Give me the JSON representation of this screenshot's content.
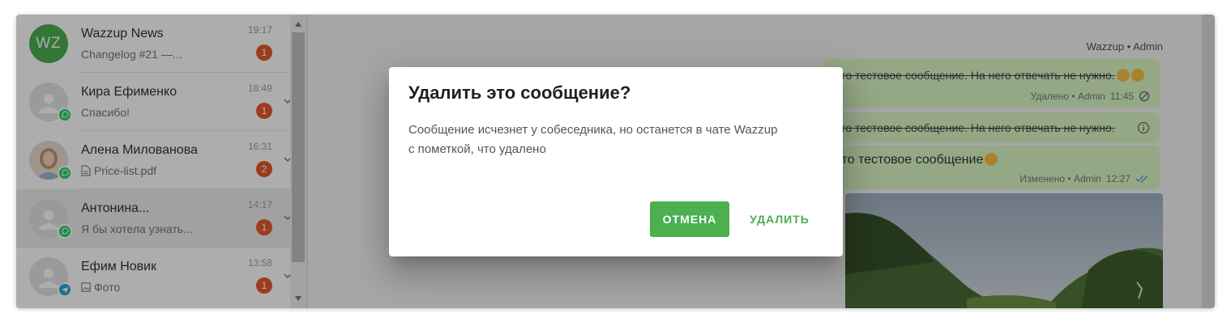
{
  "chats": [
    {
      "avatar_initials": "WZ",
      "name": "Wazzup News",
      "preview": "Changelog #21 —...",
      "time": "19:17",
      "unread": "1",
      "channel": null,
      "preview_icon": null
    },
    {
      "name": "Кира Ефименко",
      "preview": "Спасибо!",
      "time": "18:49",
      "unread": "1",
      "channel": "whatsapp",
      "preview_icon": null
    },
    {
      "name": "Алена Милованова",
      "preview": "Price-list.pdf",
      "time": "16:31",
      "unread": "2",
      "channel": "whatsapp",
      "preview_icon": "document-icon"
    },
    {
      "name": "Антонина...",
      "preview": "Я бы хотела узнать...",
      "time": "14:17",
      "unread": "1",
      "channel": "whatsapp",
      "preview_icon": null
    },
    {
      "name": "Ефим Новик",
      "preview": "Фото",
      "time": "13:58",
      "unread": "1",
      "channel": "telegram",
      "preview_icon": "image-icon"
    }
  ],
  "conversation": {
    "sender_header": "Wazzup • Admin",
    "messages": [
      {
        "text": "Это тестовое сообщение. На него отвечать не нужно.",
        "struck": true,
        "meta": "Удалено • Admin",
        "time": "11:45",
        "status_icon": "blocked-icon"
      },
      {
        "text": "Это тестовое сообщение. На него отвечать не нужно.",
        "struck": true,
        "status_icon": "info-icon"
      },
      {
        "text": "Это тестовое сообщение",
        "struck": false,
        "meta": "Изменено • Admin",
        "time": "12:27",
        "status_icon": "double-check-icon"
      }
    ]
  },
  "dialog": {
    "title": "Удалить это сообщение?",
    "body_line1": "Сообщение исчезнет у собеседника, но останется в чате Wazzup",
    "body_line2": "с пометкой, что удалено",
    "cancel_label": "ОТМЕНА",
    "delete_label": "УДАЛИТЬ"
  },
  "colors": {
    "accent_green": "#4caf50",
    "unread_badge": "#e55a2b",
    "whatsapp": "#25d366",
    "telegram": "#2aa3df",
    "bubble": "#dcf8c6"
  }
}
